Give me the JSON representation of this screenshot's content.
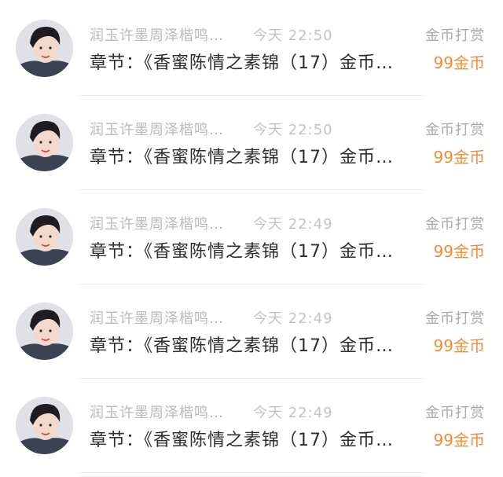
{
  "notifications": [
    {
      "sender": "润玉许墨周泽楷鸣…",
      "time": "今天 22:50",
      "tag": "金币打赏",
      "content": "章节：《香蜜陈情之素锦（17）金币…",
      "amount": "99金币"
    },
    {
      "sender": "润玉许墨周泽楷鸣…",
      "time": "今天 22:50",
      "tag": "金币打赏",
      "content": "章节：《香蜜陈情之素锦（17）金币…",
      "amount": "99金币"
    },
    {
      "sender": "润玉许墨周泽楷鸣…",
      "time": "今天 22:49",
      "tag": "金币打赏",
      "content": "章节：《香蜜陈情之素锦（17）金币…",
      "amount": "99金币"
    },
    {
      "sender": "润玉许墨周泽楷鸣…",
      "time": "今天 22:49",
      "tag": "金币打赏",
      "content": "章节：《香蜜陈情之素锦（17）金币…",
      "amount": "99金币"
    },
    {
      "sender": "润玉许墨周泽楷鸣…",
      "time": "今天 22:49",
      "tag": "金币打赏",
      "content": "章节：《香蜜陈情之素锦（17）金币…",
      "amount": "99金币"
    }
  ]
}
